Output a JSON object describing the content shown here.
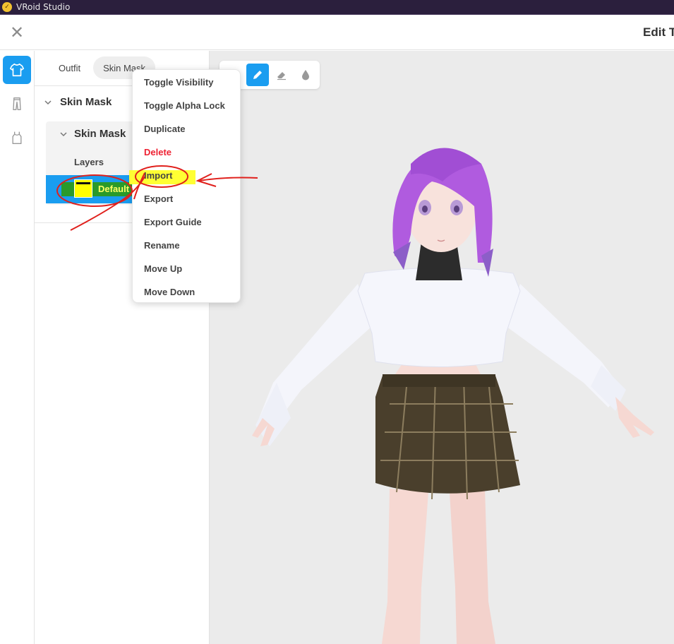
{
  "window": {
    "title": "VRoid Studio"
  },
  "header": {
    "title": "Edit T"
  },
  "side_panel": {
    "tabs": [
      {
        "label": "Outfit"
      },
      {
        "label": "Skin Mask"
      }
    ],
    "tree": {
      "root_label": "Skin Mask",
      "child_label": "Skin Mask",
      "layers_label": "Layers",
      "layer_name": "Default"
    }
  },
  "toolbar": {
    "tools": [
      "brush-icon",
      "eraser-icon",
      "fill-icon"
    ],
    "active_tool": "brush-icon"
  },
  "context_menu": {
    "items": [
      {
        "label": "Toggle Visibility"
      },
      {
        "label": "Toggle Alpha Lock"
      },
      {
        "label": "Duplicate"
      },
      {
        "label": "Delete"
      },
      {
        "label": "Import"
      },
      {
        "label": "Export"
      },
      {
        "label": "Export Guide"
      },
      {
        "label": "Rename"
      },
      {
        "label": "Move Up"
      },
      {
        "label": "Move Down"
      }
    ]
  },
  "colors": {
    "accent": "#1a9df0",
    "danger": "#ee2233",
    "titlebar": "#2b1f3d",
    "annotation_red": "#e0201c",
    "annotation_yellow": "#ffff33",
    "annotation_green": "#2a9a2a"
  }
}
